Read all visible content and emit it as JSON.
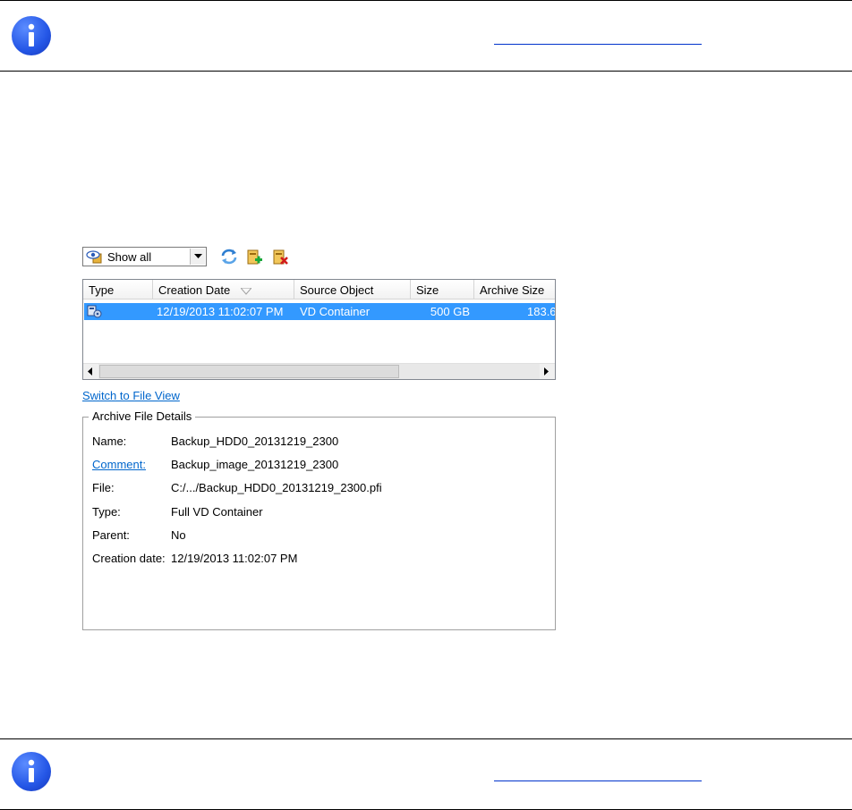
{
  "toolbar": {
    "filter": {
      "selected": "Show all"
    },
    "icons": [
      "refresh-icon",
      "add-archive-icon",
      "delete-archive-icon"
    ]
  },
  "table": {
    "columns": [
      "Type",
      "Creation Date",
      "Source Object",
      "Size",
      "Archive Size"
    ],
    "rows": [
      {
        "creation_date": "12/19/2013 11:02:07 PM",
        "source_object": "VD Container",
        "size": "500 GB",
        "archive_size": "183.6"
      }
    ]
  },
  "switch_view_link": "Switch to File View",
  "details": {
    "title": "Archive File Details",
    "fields": [
      {
        "label": "Name:",
        "value": "Backup_HDD0_20131219_2300"
      },
      {
        "label": "Comment:",
        "value": "Backup_image_20131219_2300"
      },
      {
        "label": "File:",
        "value": "C:/.../Backup_HDD0_20131219_2300.pfi"
      },
      {
        "label": "Type:",
        "value": "Full VD Container"
      },
      {
        "label": "Parent:",
        "value": "No"
      },
      {
        "label": "Creation date:",
        "value": "12/19/2013 11:02:07 PM"
      }
    ]
  },
  "colors": {
    "selection": "#3399ff",
    "link": "#0066cc",
    "info_icon": "#2456e6"
  }
}
